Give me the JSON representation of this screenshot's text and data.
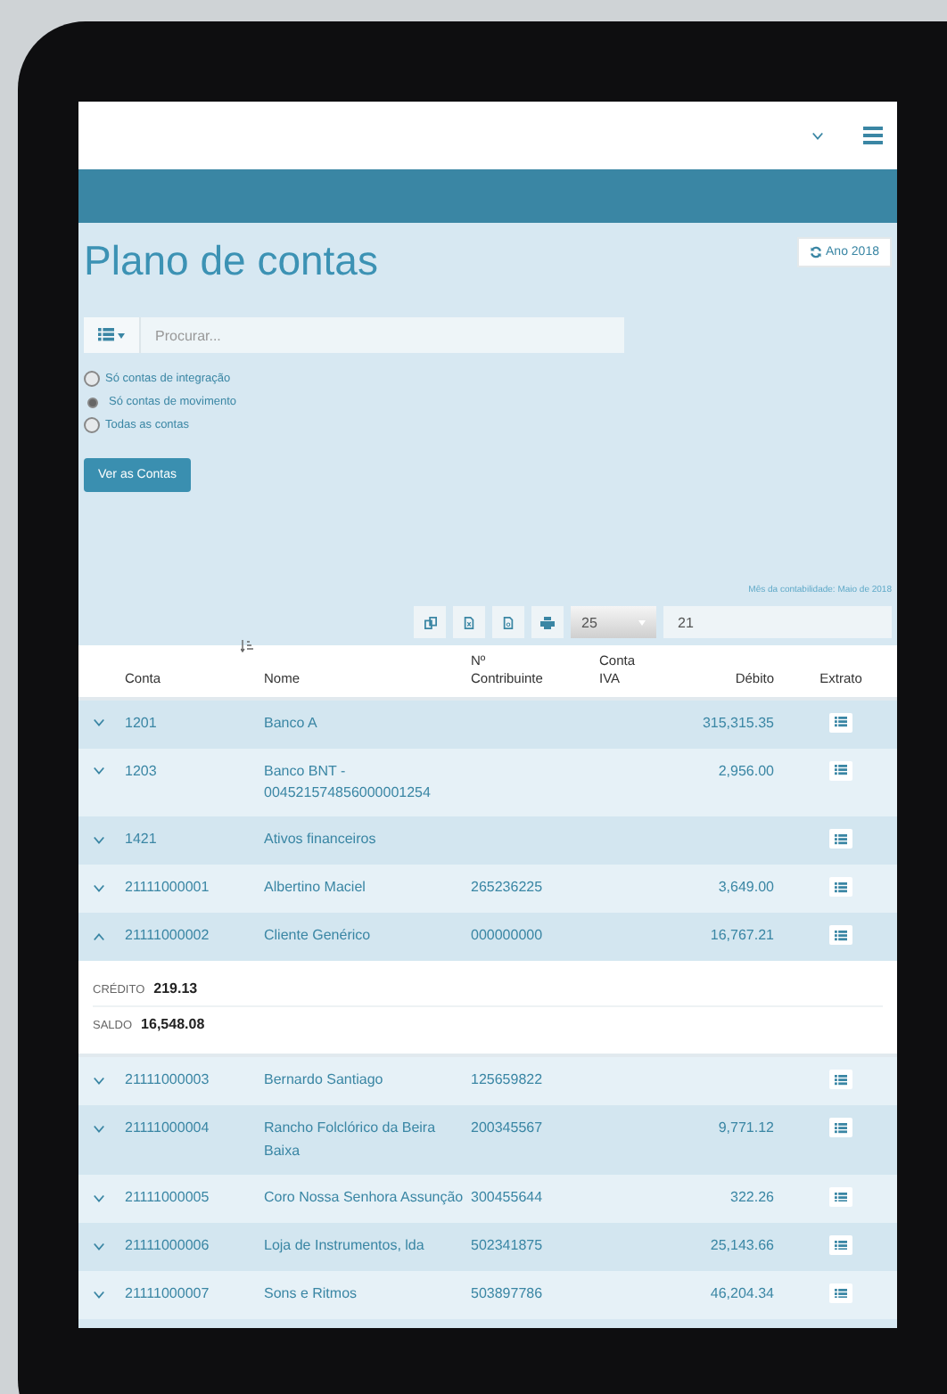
{
  "page": {
    "title": "Plano de contas",
    "year_button": "Ano 2018"
  },
  "search": {
    "placeholder": "Procurar..."
  },
  "filters": [
    {
      "label": "Só contas de integração",
      "selected": false
    },
    {
      "label": "Só contas de movimento",
      "selected": true
    },
    {
      "label": "Todas as contas",
      "selected": false
    }
  ],
  "submit_button": "Ver as Contas",
  "month_note": "Mês da contabilidade: Maio de 2018",
  "toolbar": {
    "page_size": "25",
    "page_input": "21"
  },
  "table": {
    "columns": [
      "Conta",
      "Nome",
      "Nº Contribuinte",
      "Conta IVA",
      "Débito",
      "Extrato"
    ],
    "rows": [
      {
        "conta": "1201",
        "nome": "Banco A",
        "contribuinte": "",
        "debito": "315,315.35",
        "expanded": false
      },
      {
        "conta": "1203",
        "nome": "Banco BNT - 004521574856000001254",
        "contribuinte": "",
        "debito": "2,956.00",
        "expanded": false
      },
      {
        "conta": "1421",
        "nome": "Ativos financeiros",
        "contribuinte": "",
        "debito": "",
        "expanded": false
      },
      {
        "conta": "21111000001",
        "nome": "Albertino Maciel",
        "contribuinte": "265236225",
        "debito": "3,649.00",
        "expanded": false
      },
      {
        "conta": "21111000002",
        "nome": "Cliente Genérico",
        "contribuinte": "000000000",
        "debito": "16,767.21",
        "expanded": true,
        "details": [
          {
            "label": "CRÉDITO",
            "value": "219.13"
          },
          {
            "label": "SALDO",
            "value": "16,548.08"
          }
        ]
      },
      {
        "conta": "21111000003",
        "nome": "Bernardo Santiago",
        "contribuinte": "125659822",
        "debito": "",
        "expanded": false
      },
      {
        "conta": "21111000004",
        "nome": "Rancho Folclórico da Beira Baixa",
        "contribuinte": "200345567",
        "debito": "9,771.12",
        "expanded": false
      },
      {
        "conta": "21111000005",
        "nome": "Coro Nossa Senhora Assunção",
        "contribuinte": "300455644",
        "debito": "322.26",
        "expanded": false
      },
      {
        "conta": "21111000006",
        "nome": "Loja de Instrumentos, lda",
        "contribuinte": "502341875",
        "debito": "25,143.66",
        "expanded": false
      },
      {
        "conta": "21111000007",
        "nome": "Sons e Ritmos",
        "contribuinte": "503897786",
        "debito": "46,204.34",
        "expanded": false
      }
    ]
  }
}
